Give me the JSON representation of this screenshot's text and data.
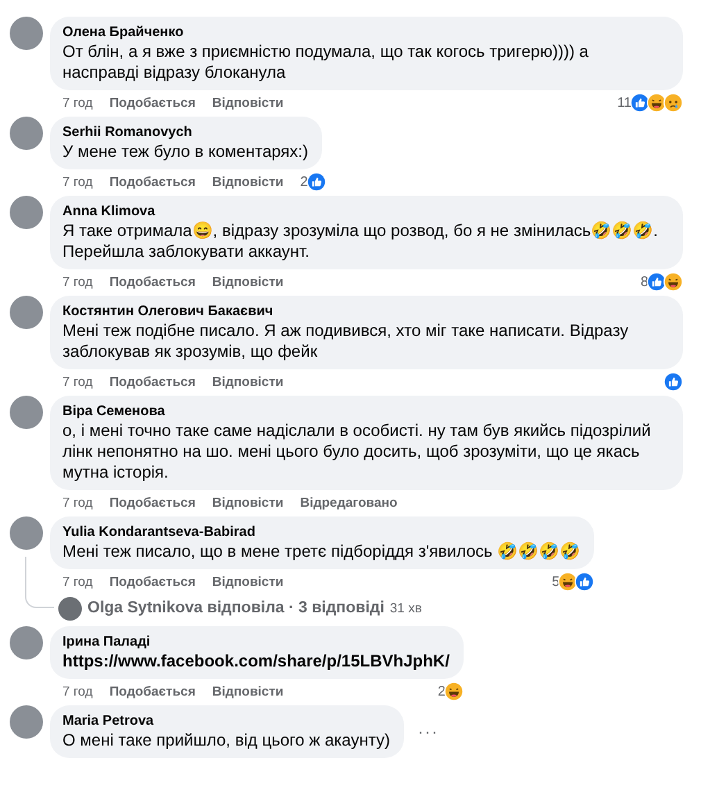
{
  "comments": [
    {
      "author": "Олена Брайченко",
      "text": "От блін, а я вже з приємністю подумала, що так когось тригерю)))) а насправді відразу блоканула",
      "time": "7 год",
      "actions": [
        "Подобається",
        "Відповісти"
      ],
      "reactions": {
        "count": "11",
        "icons": [
          {
            "kind": "like"
          },
          {
            "kind": "haha"
          },
          {
            "kind": "sad"
          }
        ]
      }
    },
    {
      "author": "Serhii Romanovych",
      "text": "У мене теж було в коментарях:)",
      "time": "7 год",
      "actions": [
        "Подобається",
        "Відповісти"
      ],
      "reactions": {
        "count": "2",
        "icons": [
          {
            "kind": "like"
          }
        ]
      }
    },
    {
      "author": "Anna Klimova",
      "text": "Я таке отримала😄, відразу зрозуміла що розвод, бо я не змінилась🤣🤣🤣. Перейшла заблокувати аккаунт.",
      "time": "7 год",
      "actions": [
        "Подобається",
        "Відповісти"
      ],
      "reactions": {
        "count": "8",
        "icons": [
          {
            "kind": "like"
          },
          {
            "kind": "haha"
          }
        ]
      }
    },
    {
      "author": "Костянтин Олегович Бакаєвич",
      "text": "Мені теж подібне писало. Я аж подивився, хто міг таке написати. Відразу заблокував як зрозумів, що фейк",
      "time": "7 год",
      "actions": [
        "Подобається",
        "Відповісти"
      ],
      "reactions": {
        "icons": [
          {
            "kind": "like"
          }
        ]
      }
    },
    {
      "author": "Віра Семенова",
      "text": "о, і мені точно таке саме надіслали в особисті. ну там був якийсь підозрілий лінк непонятно на шо. мені цього було досить, щоб зрозуміти, що це якась мутна історія.",
      "time": "7 год",
      "actions": [
        "Подобається",
        "Відповісти"
      ],
      "edited": "Відредаговано"
    },
    {
      "author": "Yulia Kondarantseva-Babirad",
      "text": "Мені теж писало, що в мене третє підборіддя з'явилось 🤣🤣🤣🤣",
      "time": "7 год",
      "actions": [
        "Подобається",
        "Відповісти"
      ],
      "reactions": {
        "count": "5",
        "icons": [
          {
            "kind": "haha"
          },
          {
            "kind": "like"
          }
        ]
      },
      "replies": {
        "summary": "Olga Sytnikova відповіла · 3 відповіді",
        "time": "31 хв"
      }
    },
    {
      "author": "Ірина Паладі",
      "link": "https://www.facebook.com/share/p/15LBVhJphK/",
      "time": "7 год",
      "actions": [
        "Подобається",
        "Відповісти"
      ],
      "reactions": {
        "count": "2",
        "icons": [
          {
            "kind": "haha"
          }
        ]
      }
    },
    {
      "author": "Maria Petrova",
      "text": "О мені таке прийшло, від цього ж акаунту)",
      "more": "···"
    }
  ]
}
